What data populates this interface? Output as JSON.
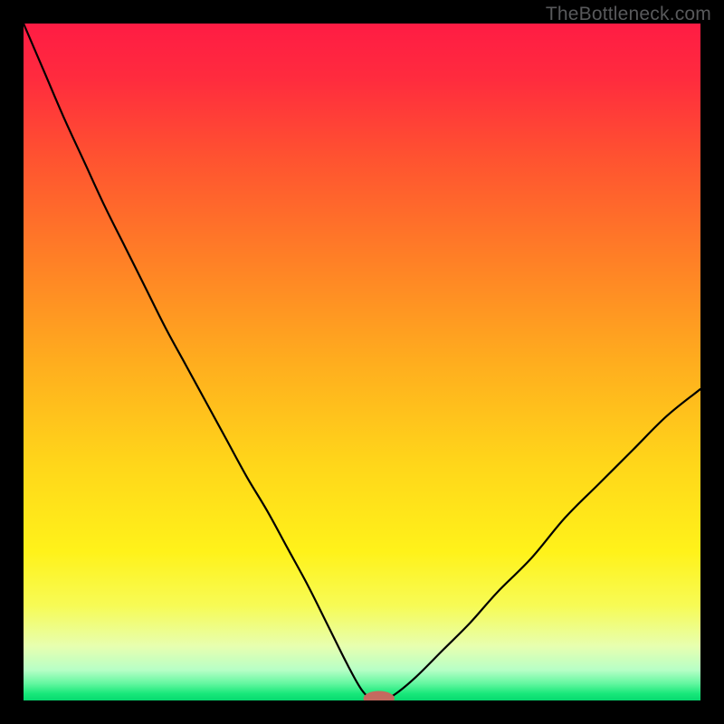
{
  "watermark": "TheBottleneck.com",
  "colors": {
    "frame": "#000000",
    "gradient_stops": [
      {
        "offset": 0.0,
        "color": "#ff1c44"
      },
      {
        "offset": 0.08,
        "color": "#ff2b3e"
      },
      {
        "offset": 0.2,
        "color": "#ff5330"
      },
      {
        "offset": 0.35,
        "color": "#ff8026"
      },
      {
        "offset": 0.5,
        "color": "#ffad1e"
      },
      {
        "offset": 0.65,
        "color": "#ffd61a"
      },
      {
        "offset": 0.78,
        "color": "#fff21a"
      },
      {
        "offset": 0.86,
        "color": "#f7fb56"
      },
      {
        "offset": 0.92,
        "color": "#e7ffb0"
      },
      {
        "offset": 0.955,
        "color": "#b7ffc6"
      },
      {
        "offset": 0.975,
        "color": "#63f7a0"
      },
      {
        "offset": 0.99,
        "color": "#18e87a"
      },
      {
        "offset": 1.0,
        "color": "#07d96f"
      }
    ],
    "curve": "#000000",
    "marker_fill": "#c46a5f",
    "marker_stroke": "#c46a5f"
  },
  "chart_data": {
    "type": "line",
    "title": "",
    "xlabel": "",
    "ylabel": "",
    "xlim": [
      0,
      100
    ],
    "ylim": [
      0,
      100
    ],
    "note": "V-shaped bottleneck curve; minimum (~0) near x≈52; left branch reaches y≈100 at x≈0; right branch reaches y≈46 at x≈100. Values estimated from pixels.",
    "series": [
      {
        "name": "bottleneck-curve",
        "x": [
          0,
          3,
          6,
          9,
          12,
          15,
          18,
          21,
          24,
          27,
          30,
          33,
          36,
          39,
          42,
          45,
          48,
          50,
          51.5,
          53.5,
          55,
          58,
          62,
          66,
          70,
          75,
          80,
          85,
          90,
          95,
          100
        ],
        "y": [
          100,
          93,
          86,
          79.5,
          73,
          67,
          61,
          55,
          49.5,
          44,
          38.5,
          33,
          28,
          22.5,
          17,
          11,
          5,
          1.5,
          0.3,
          0.3,
          1.0,
          3.5,
          7.5,
          11.5,
          16,
          21,
          27,
          32,
          37,
          42,
          46
        ]
      }
    ],
    "marker": {
      "x": 52.5,
      "y": 0.3,
      "rx": 2.3,
      "ry": 1.1
    }
  }
}
